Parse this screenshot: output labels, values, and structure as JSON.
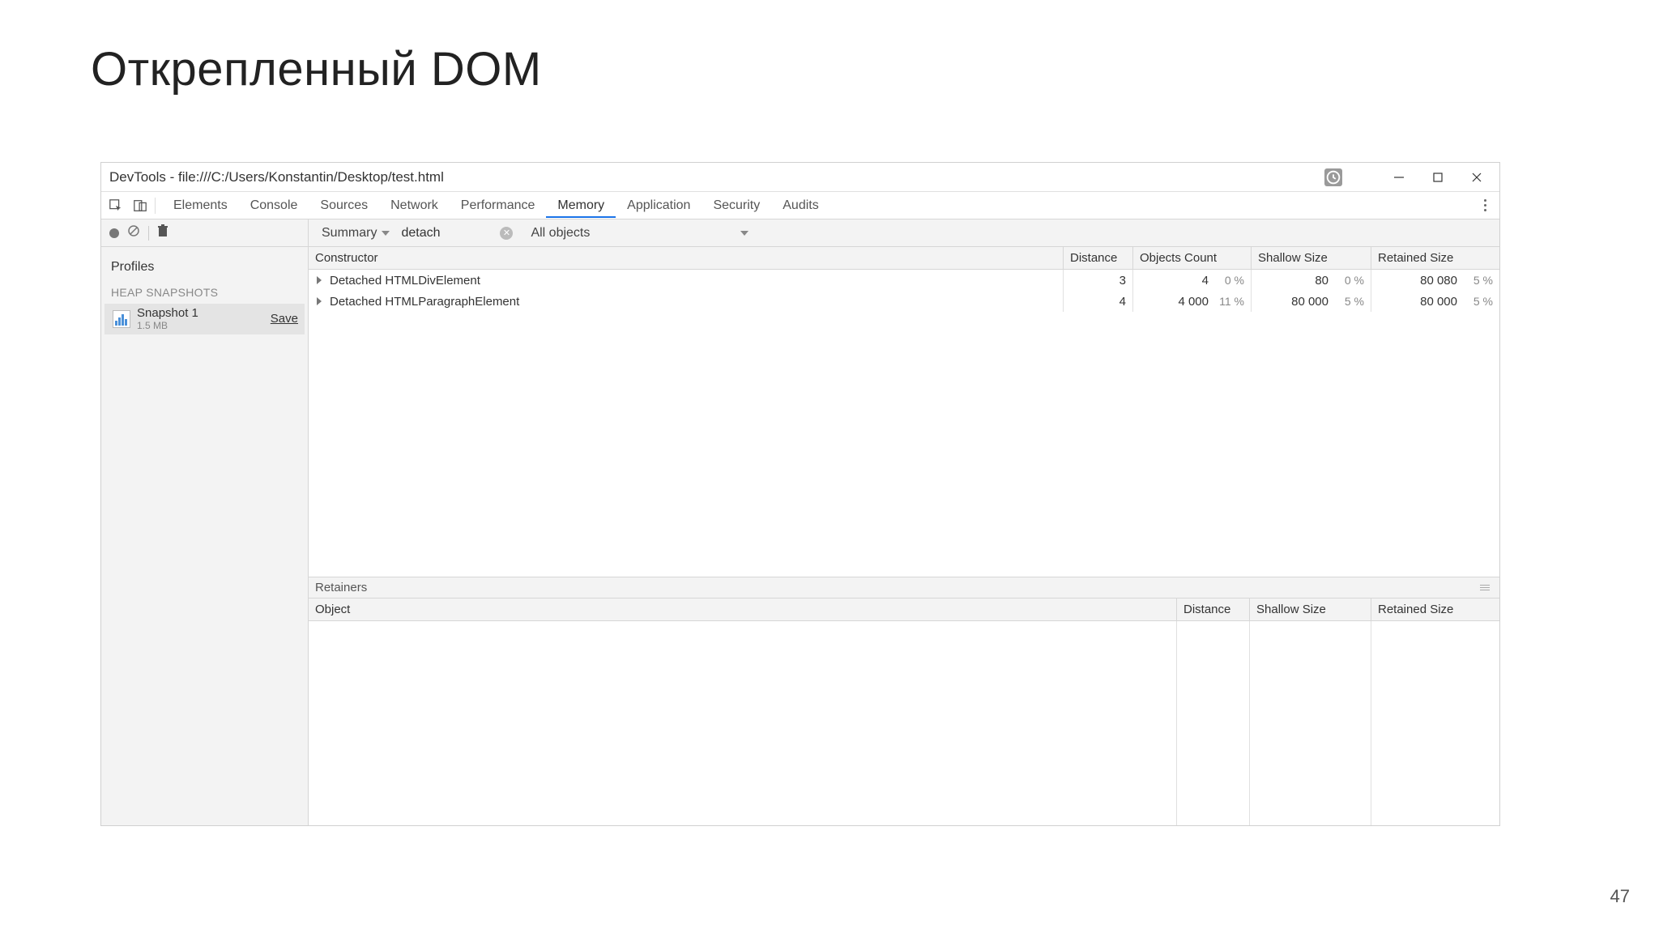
{
  "slide": {
    "title": "Открепленный DOM",
    "pageNumber": "47"
  },
  "window": {
    "title": "DevTools - file:///C:/Users/Konstantin/Desktop/test.html"
  },
  "tabs": {
    "items": [
      "Elements",
      "Console",
      "Sources",
      "Network",
      "Performance",
      "Memory",
      "Application",
      "Security",
      "Audits"
    ],
    "active": "Memory"
  },
  "sidebar": {
    "profilesLabel": "Profiles",
    "heapLabel": "HEAP SNAPSHOTS",
    "snapshot": {
      "name": "Snapshot 1",
      "size": "1.5 MB",
      "saveLabel": "Save"
    }
  },
  "toolbar": {
    "summaryLabel": "Summary",
    "filterValue": "detach",
    "allObjectsLabel": "All objects"
  },
  "columns": {
    "constructor": "Constructor",
    "distance": "Distance",
    "objectsCount": "Objects Count",
    "shallow": "Shallow Size",
    "retained": "Retained Size"
  },
  "rows": [
    {
      "constructor": "Detached HTMLDivElement",
      "distance": "3",
      "objectsCount": "4",
      "objectsPct": "0 %",
      "shallow": "80",
      "shallowPct": "0 %",
      "retained": "80 080",
      "retainedPct": "5 %"
    },
    {
      "constructor": "Detached HTMLParagraphElement",
      "distance": "4",
      "objectsCount": "4 000",
      "objectsPct": "11 %",
      "shallow": "80 000",
      "shallowPct": "5 %",
      "retained": "80 000",
      "retainedPct": "5 %"
    }
  ],
  "retainers": {
    "title": "Retainers",
    "columns": {
      "object": "Object",
      "distance": "Distance",
      "shallow": "Shallow Size",
      "retained": "Retained Size"
    }
  }
}
